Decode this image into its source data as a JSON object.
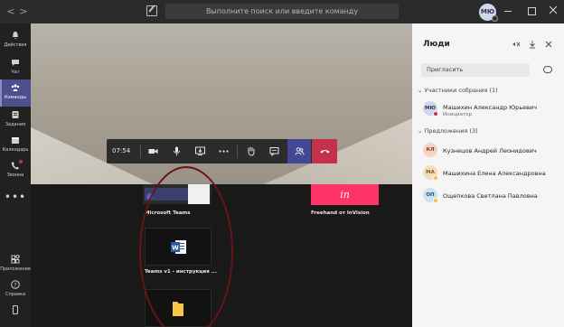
{
  "titlebar": {
    "back": "<",
    "forward": ">",
    "search_placeholder": "Выполните поиск или введите команду",
    "avatar_initials": "МЮ"
  },
  "rail": {
    "items": [
      {
        "label": "Действия",
        "icon": "bell-icon"
      },
      {
        "label": "Чат",
        "icon": "chat-icon"
      },
      {
        "label": "Команды",
        "icon": "teams-icon"
      },
      {
        "label": "Задания",
        "icon": "assignments-icon"
      },
      {
        "label": "Календарь",
        "icon": "calendar-icon"
      },
      {
        "label": "Звонки",
        "icon": "phone-icon"
      },
      {
        "label": "Приложения",
        "icon": "apps-icon"
      },
      {
        "label": "Справка",
        "icon": "help-icon"
      }
    ],
    "more": "•••"
  },
  "call": {
    "time": "07:54"
  },
  "tiles": [
    {
      "label": "Microsoft Teams"
    },
    {
      "label": "Freehand от InVision",
      "logo": "in"
    },
    {
      "label": "Teams v1 - инструкция ..."
    }
  ],
  "people": {
    "title": "Люди",
    "invite_placeholder": "Пригласить",
    "participants_header": "Участники собрания (1)",
    "participants": [
      {
        "initials": "МЮ",
        "name": "Машихин Александр Юрьевич",
        "role": "Инициатор"
      }
    ],
    "suggestions_header": "Предложения (3)",
    "suggestions": [
      {
        "initials": "КЛ",
        "name": "Кузнецов Андрей Леонидович"
      },
      {
        "initials": "МА",
        "name": "Машихина Елена Александровна"
      },
      {
        "initials": "ОП",
        "name": "Ощепкова Светлана Павловна"
      }
    ]
  },
  "colors": {
    "accent": "#4b4f8c",
    "end_call": "#c4314b",
    "invision": "#ff3366",
    "annotation": "#6b1219"
  }
}
